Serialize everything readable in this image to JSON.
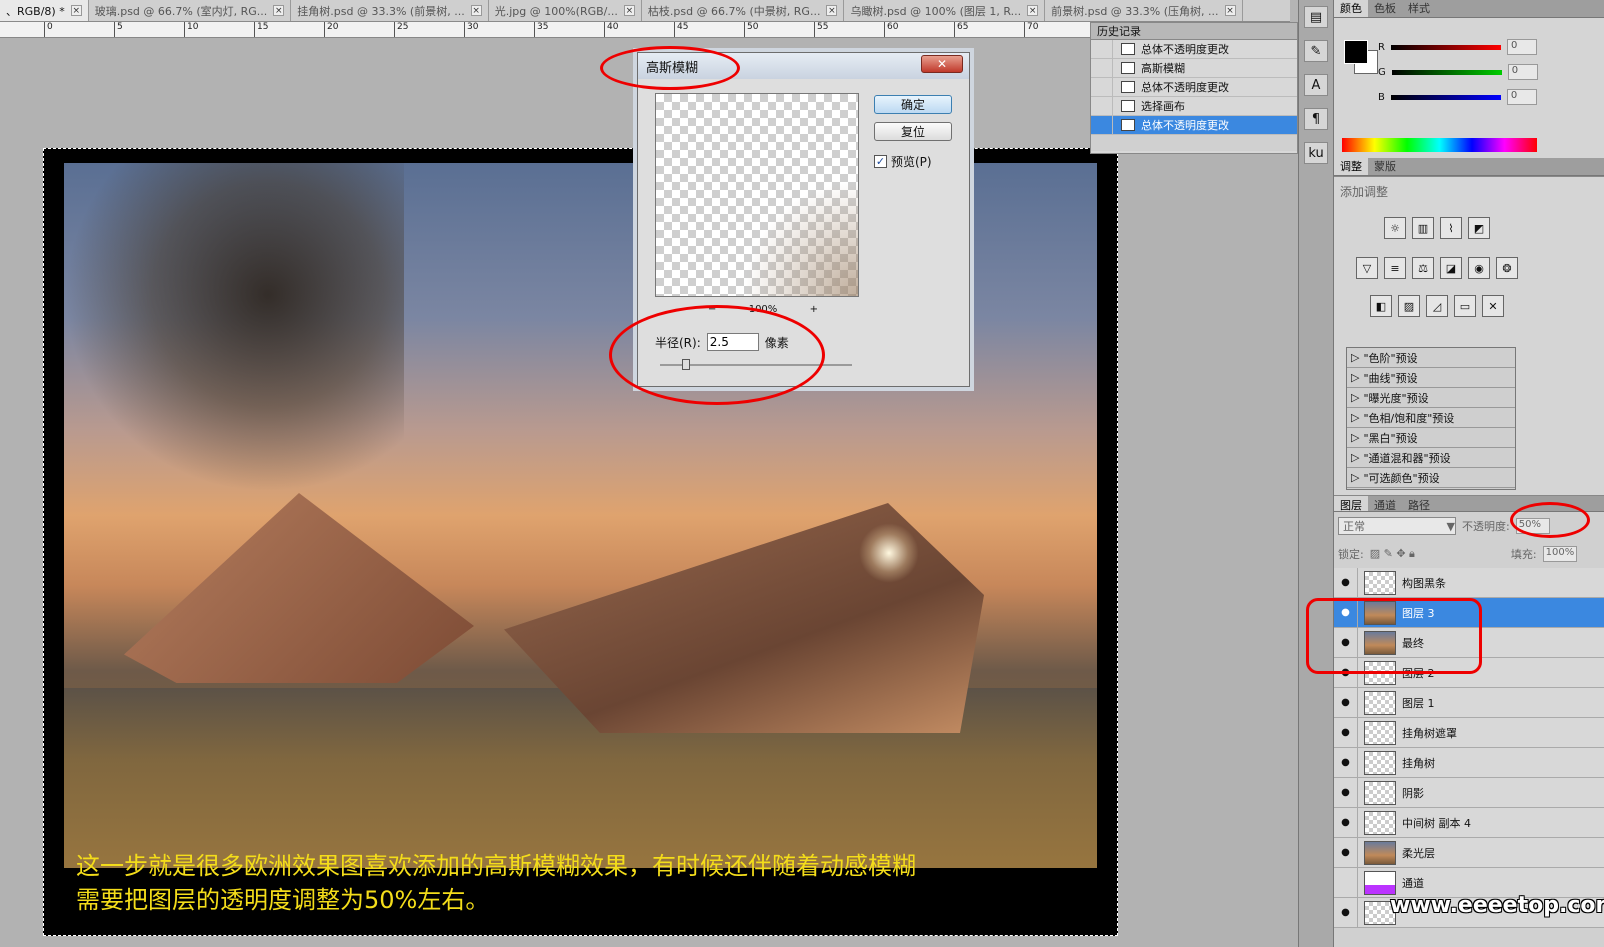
{
  "tabs": [
    {
      "label": "、RGB/8) *"
    },
    {
      "label": "玻璃.psd @ 66.7% (室内灯, RG..."
    },
    {
      "label": "挂角树.psd @ 33.3% (前景树, ..."
    },
    {
      "label": "光.jpg @ 100%(RGB/..."
    },
    {
      "label": "枯枝.psd @ 66.7% (中景树, RG..."
    },
    {
      "label": "乌瞰树.psd @ 100% (图层 1, R..."
    },
    {
      "label": "前景树.psd @ 33.3% (压角树, ..."
    }
  ],
  "tab_close": "×",
  "ruler": [
    "0",
    "5",
    "10",
    "15",
    "20",
    "25",
    "30",
    "35",
    "40",
    "45",
    "50",
    "55",
    "60",
    "65",
    "70"
  ],
  "caption": {
    "line1": "这一步就是很多欧洲效果图喜欢添加的高斯模糊效果，有时候还伴随着动感模糊",
    "line2": "需要把图层的透明度调整为50%左右。"
  },
  "dialog": {
    "title": "高斯模糊",
    "close": "✕",
    "ok": "确定",
    "reset": "复位",
    "preview_label": "预览(P)",
    "preview_checked": "✓",
    "zoom_minus": "−",
    "zoom": "100%",
    "zoom_plus": "+",
    "radius_label": "半径(R):",
    "radius_value": "2.5",
    "radius_unit": "像素"
  },
  "history": {
    "title": "历史记录",
    "items": [
      {
        "label": "总体不透明度更改"
      },
      {
        "label": "高斯模糊"
      },
      {
        "label": "总体不透明度更改"
      },
      {
        "label": "选择画布"
      },
      {
        "label": "总体不透明度更改"
      }
    ]
  },
  "tools": [
    "¶",
    "A",
    "¶",
    "ku"
  ],
  "color_panel": {
    "tabs": [
      "颜色",
      "色板",
      "样式"
    ],
    "r_label": "R",
    "g_label": "G",
    "b_label": "B",
    "r": "0",
    "g": "0",
    "b": "0"
  },
  "adjust_panel": {
    "tabs": [
      "调整",
      "蒙版"
    ],
    "title": "添加调整",
    "presets": [
      "\"色阶\"预设",
      "\"曲线\"预设",
      "\"曝光度\"预设",
      "\"色相/饱和度\"预设",
      "\"黑白\"预设",
      "\"通道混和器\"预设",
      "\"可选颜色\"预设"
    ]
  },
  "layers_panel": {
    "tabs": [
      "图层",
      "通道",
      "路径"
    ],
    "blend": "正常",
    "opacity_label": "不透明度:",
    "opacity": "50%",
    "lock_label": "锁定:",
    "fill_label": "填充:",
    "fill": "100%",
    "layers": [
      {
        "name": "构图黑条"
      },
      {
        "name": "图层 3"
      },
      {
        "name": "最终"
      },
      {
        "name": "图层 2"
      },
      {
        "name": "图层 1"
      },
      {
        "name": "挂角树遮罩"
      },
      {
        "name": "挂角树"
      },
      {
        "name": "阴影"
      },
      {
        "name": "中间树 副本 4"
      },
      {
        "name": "柔光层"
      },
      {
        "name": "通道"
      },
      {
        "name": ""
      }
    ]
  },
  "watermark": "www.eeeetop.com",
  "colors": {
    "annotation": "#e00000",
    "caption": "#f4dd1a",
    "selection": "#3b88e0"
  }
}
